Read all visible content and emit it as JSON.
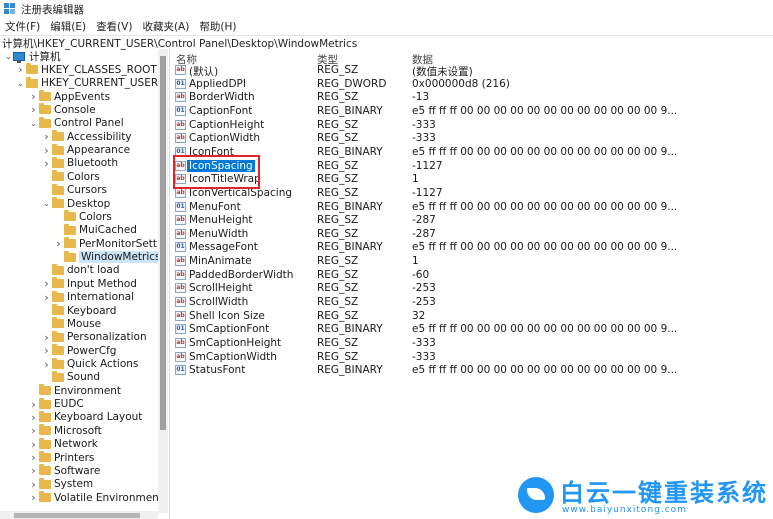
{
  "window": {
    "title": "注册表编辑器"
  },
  "menu": [
    "文件(F)",
    "编辑(E)",
    "查看(V)",
    "收藏夹(A)",
    "帮助(H)"
  ],
  "address": "计算机\\HKEY_CURRENT_USER\\Control Panel\\Desktop\\WindowMetrics",
  "tree": [
    {
      "label": "计算机",
      "level": 0,
      "expanded": true,
      "kind": "computer"
    },
    {
      "label": "HKEY_CLASSES_ROOT",
      "level": 1,
      "expanded": false
    },
    {
      "label": "HKEY_CURRENT_USER",
      "level": 1,
      "expanded": true
    },
    {
      "label": "AppEvents",
      "level": 2,
      "expanded": false
    },
    {
      "label": "Console",
      "level": 2,
      "expanded": false
    },
    {
      "label": "Control Panel",
      "level": 2,
      "expanded": true
    },
    {
      "label": "Accessibility",
      "level": 3,
      "expanded": false
    },
    {
      "label": "Appearance",
      "level": 3,
      "expanded": false
    },
    {
      "label": "Bluetooth",
      "level": 3,
      "expanded": false
    },
    {
      "label": "Colors",
      "level": 3,
      "leaf": true
    },
    {
      "label": "Cursors",
      "level": 3,
      "leaf": true
    },
    {
      "label": "Desktop",
      "level": 3,
      "expanded": true
    },
    {
      "label": "Colors",
      "level": 4,
      "leaf": true
    },
    {
      "label": "MuiCached",
      "level": 4,
      "leaf": true
    },
    {
      "label": "PerMonitorSettin",
      "level": 4,
      "expanded": false
    },
    {
      "label": "WindowMetrics",
      "level": 4,
      "leaf": true,
      "selected": true
    },
    {
      "label": "don't load",
      "level": 3,
      "leaf": true
    },
    {
      "label": "Input Method",
      "level": 3,
      "expanded": false
    },
    {
      "label": "International",
      "level": 3,
      "expanded": false
    },
    {
      "label": "Keyboard",
      "level": 3,
      "leaf": true
    },
    {
      "label": "Mouse",
      "level": 3,
      "leaf": true
    },
    {
      "label": "Personalization",
      "level": 3,
      "expanded": false
    },
    {
      "label": "PowerCfg",
      "level": 3,
      "expanded": false
    },
    {
      "label": "Quick Actions",
      "level": 3,
      "expanded": false
    },
    {
      "label": "Sound",
      "level": 3,
      "leaf": true
    },
    {
      "label": "Environment",
      "level": 2,
      "leaf": true
    },
    {
      "label": "EUDC",
      "level": 2,
      "expanded": false
    },
    {
      "label": "Keyboard Layout",
      "level": 2,
      "expanded": false
    },
    {
      "label": "Microsoft",
      "level": 2,
      "expanded": false
    },
    {
      "label": "Network",
      "level": 2,
      "expanded": false
    },
    {
      "label": "Printers",
      "level": 2,
      "expanded": false
    },
    {
      "label": "Software",
      "level": 2,
      "expanded": false
    },
    {
      "label": "System",
      "level": 2,
      "expanded": false
    },
    {
      "label": "Volatile Environment",
      "level": 2,
      "expanded": false
    }
  ],
  "columns": {
    "name": "名称",
    "type": "类型",
    "data": "数据"
  },
  "values": [
    {
      "name": "(默认)",
      "type": "REG_SZ",
      "data": "(数值未设置)",
      "icon": "ab"
    },
    {
      "name": "AppliedDPI",
      "type": "REG_DWORD",
      "data": "0x000000d8 (216)",
      "icon": "bin"
    },
    {
      "name": "BorderWidth",
      "type": "REG_SZ",
      "data": "-13",
      "icon": "ab"
    },
    {
      "name": "CaptionFont",
      "type": "REG_BINARY",
      "data": "e5 ff ff ff 00 00 00 00 00 00 00 00 00 00 00 00 9...",
      "icon": "bin"
    },
    {
      "name": "CaptionHeight",
      "type": "REG_SZ",
      "data": "-333",
      "icon": "ab"
    },
    {
      "name": "CaptionWidth",
      "type": "REG_SZ",
      "data": "-333",
      "icon": "ab"
    },
    {
      "name": "IconFont",
      "type": "REG_BINARY",
      "data": "e5 ff ff ff 00 00 00 00 00 00 00 00 00 00 00 00 9...",
      "icon": "bin"
    },
    {
      "name": "IconSpacing",
      "type": "REG_SZ",
      "data": "-1127",
      "icon": "ab",
      "selected": true
    },
    {
      "name": "IconTitleWrap",
      "type": "REG_SZ",
      "data": "1",
      "icon": "ab"
    },
    {
      "name": "IconVerticalSpacing",
      "type": "REG_SZ",
      "data": "-1127",
      "icon": "ab"
    },
    {
      "name": "MenuFont",
      "type": "REG_BINARY",
      "data": "e5 ff ff ff 00 00 00 00 00 00 00 00 00 00 00 00 9...",
      "icon": "bin"
    },
    {
      "name": "MenuHeight",
      "type": "REG_SZ",
      "data": "-287",
      "icon": "ab"
    },
    {
      "name": "MenuWidth",
      "type": "REG_SZ",
      "data": "-287",
      "icon": "ab"
    },
    {
      "name": "MessageFont",
      "type": "REG_BINARY",
      "data": "e5 ff ff ff 00 00 00 00 00 00 00 00 00 00 00 00 9...",
      "icon": "bin"
    },
    {
      "name": "MinAnimate",
      "type": "REG_SZ",
      "data": "1",
      "icon": "ab"
    },
    {
      "name": "PaddedBorderWidth",
      "type": "REG_SZ",
      "data": "-60",
      "icon": "ab"
    },
    {
      "name": "ScrollHeight",
      "type": "REG_SZ",
      "data": "-253",
      "icon": "ab"
    },
    {
      "name": "ScrollWidth",
      "type": "REG_SZ",
      "data": "-253",
      "icon": "ab"
    },
    {
      "name": "Shell Icon Size",
      "type": "REG_SZ",
      "data": "32",
      "icon": "ab"
    },
    {
      "name": "SmCaptionFont",
      "type": "REG_BINARY",
      "data": "e5 ff ff ff 00 00 00 00 00 00 00 00 00 00 00 00 9...",
      "icon": "bin"
    },
    {
      "name": "SmCaptionHeight",
      "type": "REG_SZ",
      "data": "-333",
      "icon": "ab"
    },
    {
      "name": "SmCaptionWidth",
      "type": "REG_SZ",
      "data": "-333",
      "icon": "ab"
    },
    {
      "name": "StatusFont",
      "type": "REG_BINARY",
      "data": "e5 ff ff ff 00 00 00 00 00 00 00 00 00 00 00 00 9...",
      "icon": "bin"
    }
  ],
  "watermark": {
    "main": "白云一键重装系统",
    "url": "www.baiyunxitong.com"
  },
  "colors": {
    "selection": "#0078d7",
    "highlight_box": "#e0232b",
    "folder": "#e8b84b",
    "brand": "#2196f3"
  }
}
